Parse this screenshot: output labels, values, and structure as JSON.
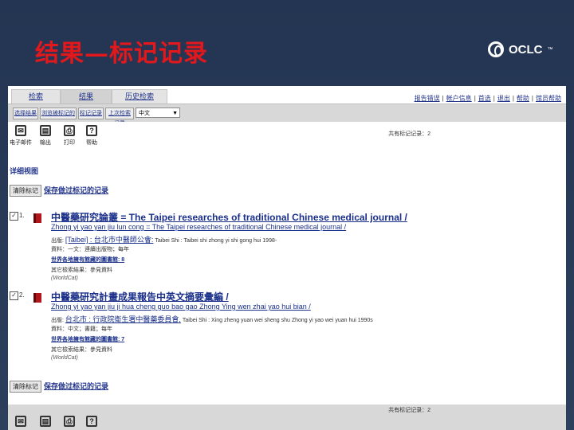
{
  "slide": {
    "title": "结果—标记记录",
    "brand": "OCLC",
    "brand_tm": "™"
  },
  "tabs": [
    "检索",
    "结果",
    "历史检索"
  ],
  "toplinks": [
    "报告错误",
    "帐户信息",
    "首选",
    "退出",
    "帮助",
    "馆员帮助"
  ],
  "subnav": {
    "buttons": [
      "选择结果",
      "浏览被标记的",
      "标记记录",
      "上次检索记录"
    ],
    "select_value": "中文"
  },
  "tools": [
    "电子邮件",
    "输出",
    "打印",
    "帮助"
  ],
  "record_count": "共有标记记录：2",
  "page_label": "详细视图",
  "actions": {
    "clear_label": "清除标记",
    "save_link": "保存做过标记的记录"
  },
  "records": [
    {
      "num": "1.",
      "title": "中醫藥研究論叢 = The Taipei researches of traditional Chinese medical journal /",
      "romanized": "Zhong yi yao yan jiu lun cong = The Taipei researches of traditional Chinese medical journal /",
      "publisher_prefix": "出版:",
      "publisher": "[Taibei] : 台北市中醫師公會:",
      "publisher_suffix": "Taibei Shi : Taibei shi zhong yi shi gong hui 1998-",
      "format": "資料：一文：連續出版物；每年",
      "holdings_link": "世界各地擁有館藏的圖書館: 8",
      "other": "其它檢索結果：參見資料",
      "source": "(WorldCat)"
    },
    {
      "num": "2.",
      "title": "中醫藥研究計畫成果報告中英文摘要彙編 /",
      "romanized": "Zhong yi yao yan jiu ji hua cheng guo bao gao Zhong Ying wen zhai yao hui bian /",
      "publisher_prefix": "出版:",
      "publisher": "台北市 : 行政院衛生署中醫藥委員會,",
      "publisher_suffix": "Taibei Shi : Xing zheng yuan wei sheng shu Zhong yi yao wei yuan hui 1990s",
      "format": "資料：中文；書籍；每年",
      "holdings_link": "世界各地擁有館藏的圖書館: 7",
      "other": "其它檢索結果：參見資料",
      "source": "(WorldCat)"
    }
  ],
  "colors": {
    "title_red": "#e2181c",
    "link_blue": "#1a2f8a",
    "slide_bg": "#26364f"
  }
}
